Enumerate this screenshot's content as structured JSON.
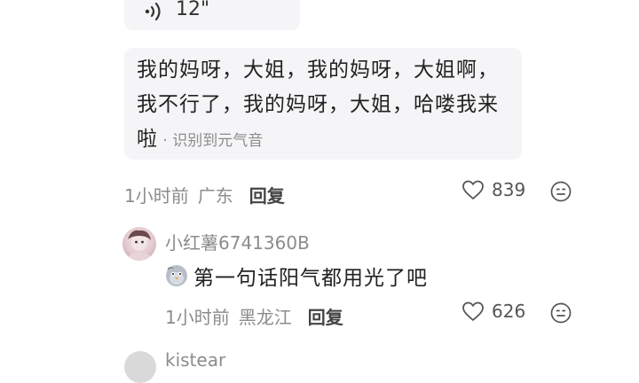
{
  "voice_message": {
    "duration": "12\"",
    "icon": "voice-wave-icon"
  },
  "comment": {
    "transcript": "我的妈呀，大姐，我的妈呀，大姐啊，我不行了，我的妈呀，大姐，哈喽我来啦",
    "transcript_tag": " · 识别到元气音",
    "time": "1小时前",
    "location": "广东",
    "reply_label": "回复",
    "likes": "839"
  },
  "reply": {
    "username": "小红薯6741360B",
    "sticker": "pigeon-face-icon",
    "text": "第一句话阳气都用光了吧",
    "time": "1小时前",
    "location": "黑龙江",
    "reply_label": "回复",
    "likes": "626"
  },
  "next_comment": {
    "username": "kistear"
  }
}
